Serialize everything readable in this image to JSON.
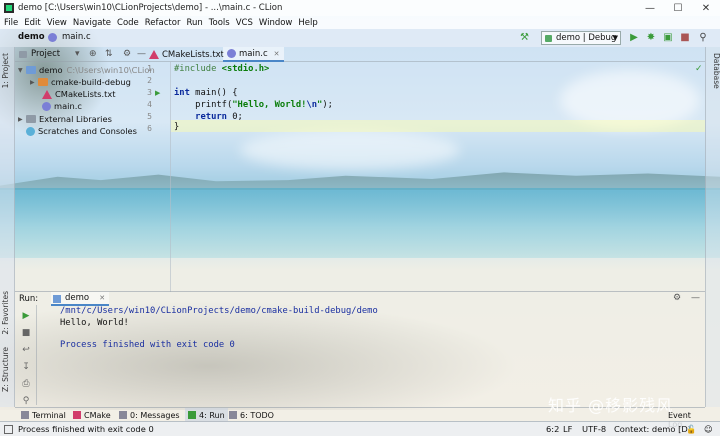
{
  "window": {
    "title": "demo [C:\\Users\\win10\\CLionProjects\\demo] - ...\\main.c - CLion",
    "controls": [
      "—",
      "☐",
      "✕"
    ]
  },
  "menu": [
    "File",
    "Edit",
    "View",
    "Navigate",
    "Code",
    "Refactor",
    "Run",
    "Tools",
    "VCS",
    "Window",
    "Help"
  ],
  "navbar": {
    "project": "demo",
    "file": "main.c",
    "config": "demo | Debug"
  },
  "left_strip": {
    "project_tab": "1: Project",
    "favorites_tab": "2: Favorites",
    "structure_tab": "Z: Structure"
  },
  "right_strip": {
    "database_tab": "Database"
  },
  "project_panel": {
    "header": "Project",
    "tree": [
      {
        "label": "demo",
        "path": "C:\\Users\\win10\\CLion",
        "icon": "folder-icon"
      },
      {
        "label": "cmake-build-debug",
        "icon": "folder-orange-icon"
      },
      {
        "label": "CMakeLists.txt",
        "icon": "cmake-icon"
      },
      {
        "label": "main.c",
        "icon": "c-file-icon"
      },
      {
        "label": "External Libraries",
        "icon": "library-icon"
      },
      {
        "label": "Scratches and Consoles",
        "icon": "scratch-icon"
      }
    ]
  },
  "editor": {
    "tabs": [
      {
        "label": "CMakeLists.txt",
        "active": false
      },
      {
        "label": "main.c",
        "active": true
      }
    ],
    "line_numbers": [
      "1",
      "2",
      "3",
      "4",
      "5",
      "6"
    ],
    "code": {
      "l1_pp": "#include ",
      "l1_hdr": "<stdio.h>",
      "l3_kw": "int",
      "l3_rest": " main() {",
      "l4_fn": "    printf(",
      "l4_str1": "\"Hello, World!",
      "l4_esc": "\\n",
      "l4_str2": "\"",
      "l4_end": ");",
      "l5_kw": "    return",
      "l5_rest": " 0;",
      "l6": "}"
    }
  },
  "run_panel": {
    "label": "Run:",
    "tab": "demo",
    "output": [
      "/mnt/c/Users/win10/CLionProjects/demo/cmake-build-debug/demo",
      "Hello, World!",
      "",
      "Process finished with exit code 0"
    ]
  },
  "tool_tabs": [
    {
      "label": "Terminal"
    },
    {
      "label": "CMake"
    },
    {
      "label": "0: Messages"
    },
    {
      "label": "4: Run"
    },
    {
      "label": "6: TODO"
    }
  ],
  "event_log": "Event Log",
  "status": {
    "message": "Process finished with exit code 0",
    "position": "6:2",
    "line_sep": "LF",
    "encoding": "UTF-8",
    "context": "Context: demo [D]"
  },
  "watermark": "知乎 @移影残风"
}
